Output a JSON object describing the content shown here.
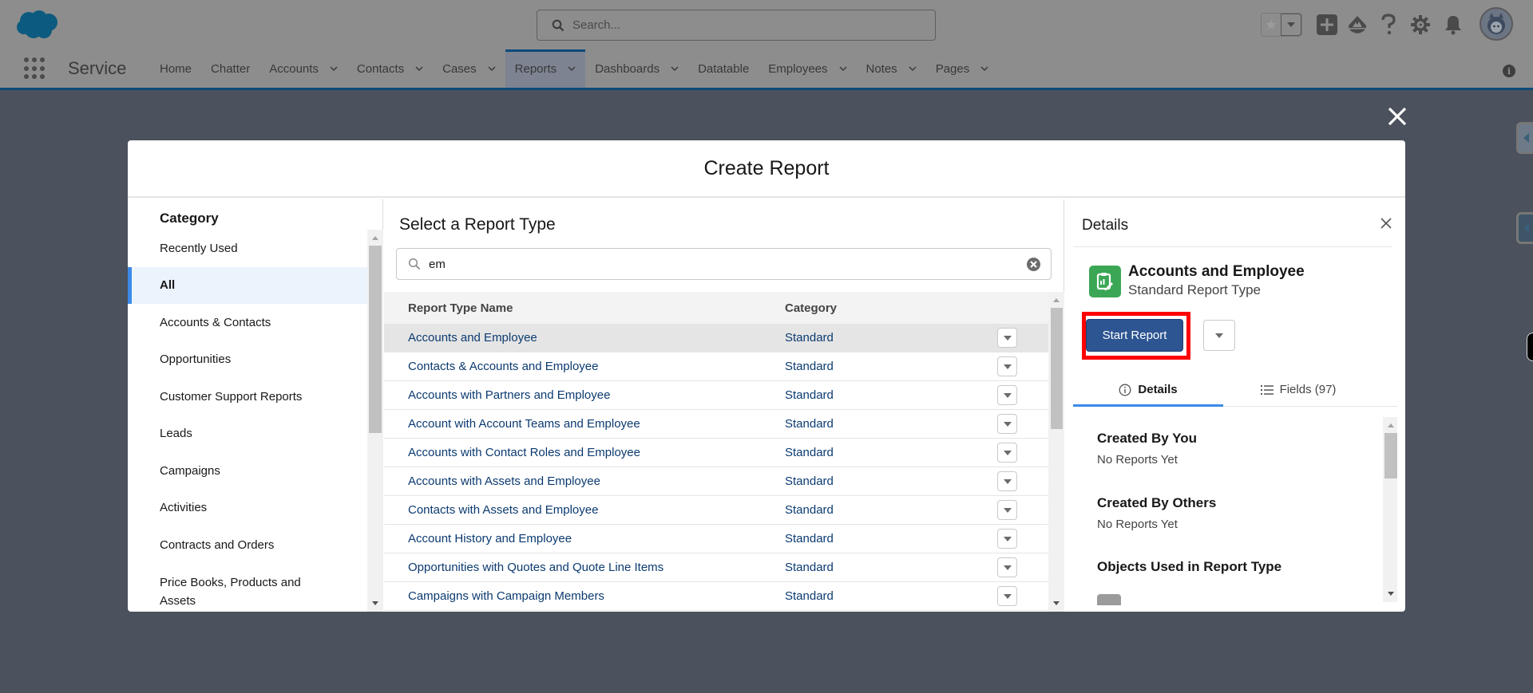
{
  "header": {
    "search_placeholder": "Search...",
    "app_name": "Service",
    "nav": [
      {
        "label": "Home",
        "has_menu": false
      },
      {
        "label": "Chatter",
        "has_menu": false
      },
      {
        "label": "Accounts",
        "has_menu": true
      },
      {
        "label": "Contacts",
        "has_menu": true
      },
      {
        "label": "Cases",
        "has_menu": true
      },
      {
        "label": "Reports",
        "has_menu": true,
        "active": true
      },
      {
        "label": "Dashboards",
        "has_menu": true
      },
      {
        "label": "Datatable",
        "has_menu": false
      },
      {
        "label": "Employees",
        "has_menu": true
      },
      {
        "label": "Notes",
        "has_menu": true
      },
      {
        "label": "Pages",
        "has_menu": true
      }
    ],
    "icons": [
      "favorites-star-icon",
      "add-icon",
      "trailhead-icon",
      "help-icon",
      "setup-gear-icon",
      "notifications-bell-icon",
      "user-avatar"
    ],
    "info_glyph": "i"
  },
  "modal": {
    "title": "Create Report",
    "category": {
      "heading": "Category",
      "items": [
        {
          "label": "Recently Used"
        },
        {
          "label": "All",
          "active": true
        },
        {
          "label": "Accounts & Contacts"
        },
        {
          "label": "Opportunities"
        },
        {
          "label": "Customer Support Reports"
        },
        {
          "label": "Leads"
        },
        {
          "label": "Campaigns"
        },
        {
          "label": "Activities"
        },
        {
          "label": "Contracts and Orders"
        },
        {
          "label": "Price Books, Products and Assets"
        }
      ]
    },
    "report_types": {
      "heading": "Select a Report Type",
      "search_value": "em",
      "columns": [
        "Report Type Name",
        "Category"
      ],
      "rows": [
        {
          "name": "Accounts and Employee",
          "category": "Standard",
          "selected": true
        },
        {
          "name": "Contacts & Accounts and Employee",
          "category": "Standard"
        },
        {
          "name": "Accounts with Partners and Employee",
          "category": "Standard"
        },
        {
          "name": "Account with Account Teams and Employee",
          "category": "Standard"
        },
        {
          "name": "Accounts with Contact Roles and Employee",
          "category": "Standard"
        },
        {
          "name": "Accounts with Assets and Employee",
          "category": "Standard"
        },
        {
          "name": "Contacts with Assets and Employee",
          "category": "Standard"
        },
        {
          "name": "Account History and Employee",
          "category": "Standard"
        },
        {
          "name": "Opportunities with Quotes and Quote Line Items",
          "category": "Standard"
        },
        {
          "name": "Campaigns with Campaign Members",
          "category": "Standard"
        }
      ]
    },
    "details": {
      "heading": "Details",
      "report_type_name": "Accounts and Employee",
      "report_type_kind": "Standard Report Type",
      "start_button": "Start Report",
      "tabs": [
        {
          "label": "Details",
          "active": true,
          "icon": "info-icon"
        },
        {
          "label": "Fields (97)",
          "icon": "list-icon"
        }
      ],
      "sections": [
        {
          "title": "Created By You",
          "value": "No Reports Yet"
        },
        {
          "title": "Created By Others",
          "value": "No Reports Yet"
        },
        {
          "title": "Objects Used in Report Type",
          "value": ""
        }
      ]
    }
  },
  "colors": {
    "brand_blue": "#2d5591",
    "accent_blue": "#3c8ae8",
    "link_blue": "#0b3a70",
    "report_icon_green": "#3ba755",
    "highlight_red": "#ff0000",
    "backdrop": "#4b515d"
  }
}
